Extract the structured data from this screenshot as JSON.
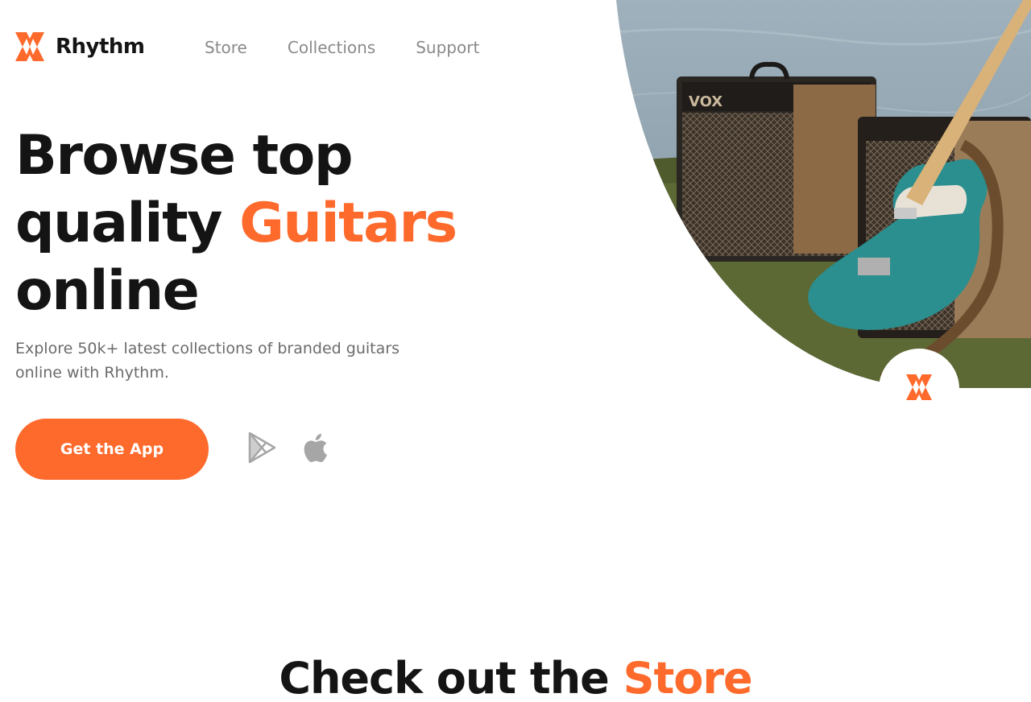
{
  "brand": {
    "name": "Rhythm",
    "accent_color": "#fe6a2c",
    "logo_icon": "rhythm-logo-mark"
  },
  "nav": {
    "items": [
      {
        "label": "Store"
      },
      {
        "label": "Collections"
      },
      {
        "label": "Support"
      }
    ]
  },
  "hero": {
    "title_line1": "Browse top",
    "title_line2_plain": "quality ",
    "title_line2_accent": "Guitars",
    "title_line3": "online",
    "subtitle": "Explore 50k+ latest collections of branded guitars online with Rhythm.",
    "cta_label": "Get the App",
    "store_icons": [
      "google-play-icon",
      "apple-icon"
    ],
    "image_subject": "hero-photo-guitar-amps"
  },
  "store_section": {
    "title_plain": "Check out the ",
    "title_accent": "Store"
  }
}
